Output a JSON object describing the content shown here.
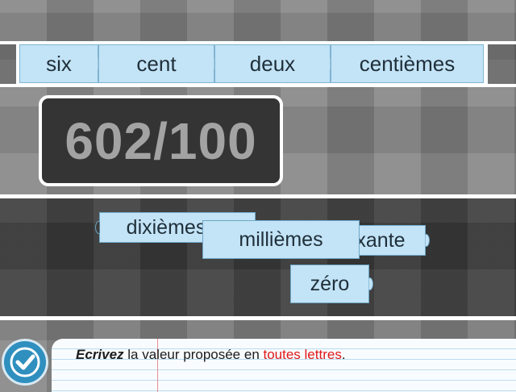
{
  "answer_slots": [
    "six",
    "cent",
    "deux",
    "centièmes"
  ],
  "fraction": "602/100",
  "pool_tiles": {
    "dixiemes": "dixièmes",
    "milliemes": "millièmes",
    "soixante": "soixante",
    "zero": "zéro"
  },
  "instruction": {
    "verb": "Ecrivez",
    "middle": " la valeur proposée en ",
    "highlight": "toutes lettres",
    "end": "."
  },
  "colors": {
    "tile": "#c3e3f6",
    "highlight": "#e01818",
    "validate_button": "#2f8fbf"
  },
  "icons": {
    "validate": "checkmark-icon"
  }
}
